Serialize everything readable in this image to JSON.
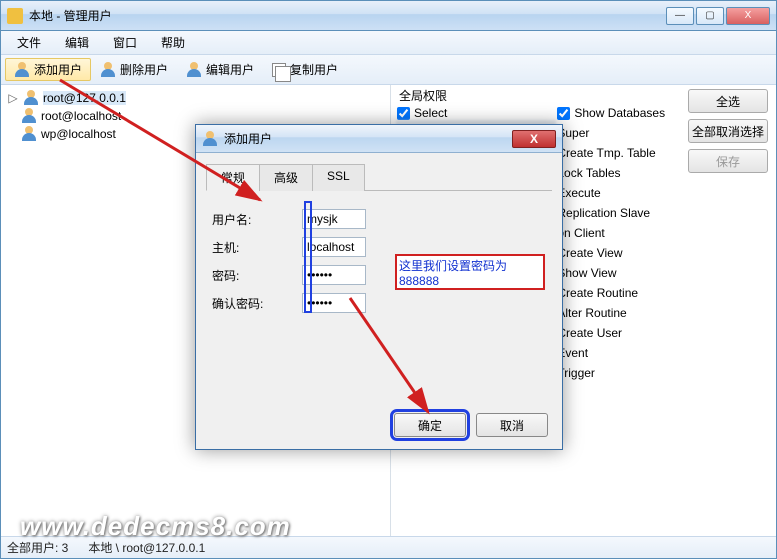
{
  "window": {
    "title": "本地 - 管理用户",
    "min": "—",
    "max": "▢",
    "close": "X"
  },
  "menu": {
    "file": "文件",
    "edit": "编辑",
    "window": "窗口",
    "help": "帮助"
  },
  "toolbar": {
    "add_user": "添加用户",
    "delete_user": "删除用户",
    "edit_user": "编辑用户",
    "copy_user": "复制用户"
  },
  "tree": {
    "items": [
      {
        "label": "root@127.0.0.1"
      },
      {
        "label": "root@localhost"
      },
      {
        "label": "wp@localhost"
      }
    ]
  },
  "right": {
    "group_title": "全局权限",
    "permissions": [
      "Select",
      "Show Databases",
      "Super",
      "Create Tmp. Table",
      "Lock Tables",
      "Execute",
      "Replication Slave",
      "on Client",
      "Create View",
      "Show View",
      "Create Routine",
      "Alter Routine",
      "Create User",
      "Event",
      "Trigger"
    ],
    "buttons": {
      "select_all": "全选",
      "deselect_all": "全部取消选择",
      "save": "保存"
    }
  },
  "dialog": {
    "title": "添加用户",
    "tabs": {
      "general": "常规",
      "advanced": "高级",
      "ssl": "SSL"
    },
    "labels": {
      "username": "用户名:",
      "host": "主机:",
      "password": "密码:",
      "confirm": "确认密码:"
    },
    "values": {
      "username": "mysjk",
      "host": "localhost",
      "password": "••••••",
      "confirm": "••••••"
    },
    "ok": "确定",
    "cancel": "取消"
  },
  "callout": "这里我们设置密码为888888",
  "status": {
    "count_label": "全部用户: 3",
    "path": "本地 \\ root@127.0.0.1"
  },
  "watermark": "www.dedecms8.com"
}
